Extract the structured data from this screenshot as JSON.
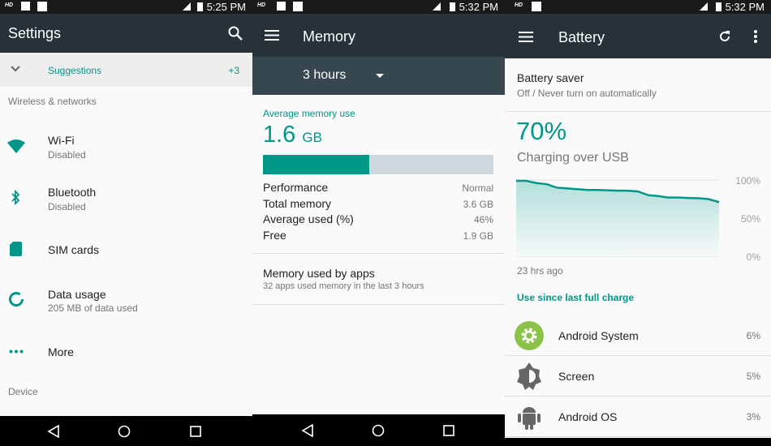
{
  "settings": {
    "status": {
      "time": "5:25 PM",
      "hd": "HD"
    },
    "title": "Settings",
    "suggestions": {
      "label": "Suggestions",
      "count": "+3"
    },
    "section_wireless": "Wireless & networks",
    "items": [
      {
        "icon": "wifi-icon",
        "title": "Wi-Fi",
        "subtitle": "Disabled"
      },
      {
        "icon": "bluetooth-icon",
        "title": "Bluetooth",
        "subtitle": "Disabled"
      },
      {
        "icon": "sim-card-icon",
        "title": "SIM cards",
        "subtitle": ""
      },
      {
        "icon": "data-usage-icon",
        "title": "Data usage",
        "subtitle": "205 MB of data used"
      },
      {
        "icon": "more-icon",
        "title": "More",
        "subtitle": ""
      }
    ],
    "section_device": "Device"
  },
  "memory": {
    "status": {
      "time": "5:32 PM",
      "hd": "HD"
    },
    "title": "Memory",
    "period": "3 hours",
    "avg_label": "Average memory use",
    "avg_value": "1.6",
    "avg_unit": "GB",
    "used_percent": 46,
    "stats": [
      {
        "label": "Performance",
        "value": "Normal"
      },
      {
        "label": "Total memory",
        "value": "3.6 GB"
      },
      {
        "label": "Average used (%)",
        "value": "46%"
      },
      {
        "label": "Free",
        "value": "1.9 GB"
      }
    ],
    "apps_title": "Memory used by apps",
    "apps_subtitle": "32 apps used memory in the last 3 hours"
  },
  "battery": {
    "status": {
      "time": "5:32 PM",
      "hd": "HD"
    },
    "title": "Battery",
    "saver_title": "Battery saver",
    "saver_subtitle": "Off / Never turn on automatically",
    "level": "70%",
    "charging": "Charging over USB",
    "since_label": "23 hrs ago",
    "use_since": "Use since last full charge",
    "usage": [
      {
        "icon": "android-system-icon",
        "name": "Android System",
        "percent": "6%"
      },
      {
        "icon": "screen-brightness-icon",
        "name": "Screen",
        "percent": "5%"
      },
      {
        "icon": "android-os-icon",
        "name": "Android OS",
        "percent": "3%"
      }
    ],
    "accent": "#009688"
  },
  "chart_data": {
    "type": "area",
    "ytick_labels": [
      "100%",
      "50%",
      "0%"
    ],
    "ylim": [
      0,
      100
    ],
    "xlabel": "23 hrs ago",
    "grid": true,
    "x_hours_ago": [
      23,
      21.9,
      20.7,
      19.5,
      18.4,
      17.2,
      16.1,
      14.9,
      13.8,
      11.5,
      10.4,
      9.2,
      8,
      6.9,
      5.8,
      4.6,
      3.5,
      2.3,
      1.2,
      0
    ],
    "y": [
      99,
      99,
      96,
      94.5,
      90,
      89,
      88,
      87,
      87,
      86,
      86,
      85,
      80,
      79,
      77,
      77,
      76.5,
      76,
      75,
      71
    ]
  }
}
